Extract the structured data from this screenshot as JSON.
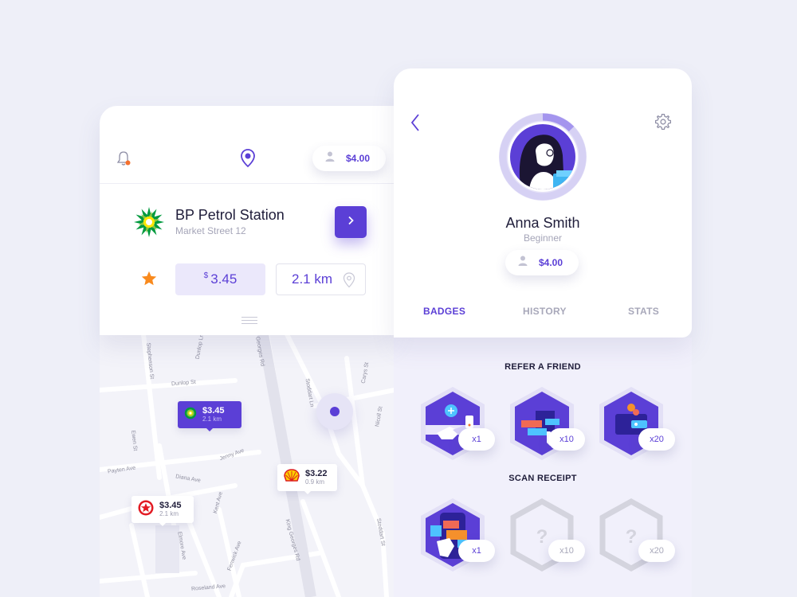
{
  "station_card": {
    "notification_icon": "bell-icon",
    "location_icon": "map-pin-icon",
    "wallet": {
      "icon": "user-icon",
      "amount": "$4.00"
    },
    "station": {
      "logo": "bp-logo-icon",
      "name": "BP Petrol Station",
      "address": "Market Street 12",
      "go_icon": "chevron-right-icon"
    },
    "favorite_icon": "star-icon",
    "price": {
      "currency": "$",
      "value": "3.45"
    },
    "distance": {
      "value": "2.1 km",
      "icon": "location-outline-icon"
    },
    "handle_icon": "drag-handle-icon"
  },
  "map": {
    "streets": [
      "Dunlop Ln",
      "Dunlop St",
      "Stephenson St",
      "Georges Rd",
      "Ewen St",
      "Payten Ave",
      "Diana Ave",
      "Kent Ave",
      "Fenwick Ave",
      "Roseland Ave",
      "Stoddart Ln",
      "Carys St",
      "Nicoll St",
      "King Georges Rd",
      "Jenny Ave",
      "Elmore Ave",
      "Stoddart St"
    ],
    "pins": [
      {
        "brand": "bp-logo-icon",
        "price": "$3.45",
        "distance": "2.1 km",
        "active": true
      },
      {
        "brand": "shell-logo-icon",
        "price": "$3.22",
        "distance": "0.9 km",
        "active": false
      },
      {
        "brand": "texaco-logo-icon",
        "price": "$3.45",
        "distance": "2.1 km",
        "active": false
      }
    ],
    "current_location_icon": "current-location-icon"
  },
  "profile": {
    "back_icon": "chevron-left-icon",
    "settings_icon": "gear-icon",
    "avatar": "user-avatar",
    "name": "Anna Smith",
    "level": "Beginner",
    "level_progress": 0.3,
    "wallet": {
      "icon": "user-icon",
      "amount": "$4.00"
    },
    "tabs": [
      {
        "label": "BADGES",
        "active": true
      },
      {
        "label": "HISTORY",
        "active": false
      },
      {
        "label": "STATS",
        "active": false
      }
    ]
  },
  "badges": {
    "sections": [
      {
        "title": "REFER A FRIEND",
        "items": [
          {
            "icon": "handshake-badge-icon",
            "count": "x1",
            "locked": false
          },
          {
            "icon": "cards-badge-icon",
            "count": "x10",
            "locked": false
          },
          {
            "icon": "wallet-badge-icon",
            "count": "x20",
            "locked": false
          }
        ]
      },
      {
        "title": "SCAN RECEIPT",
        "items": [
          {
            "icon": "scan-badge-icon",
            "count": "x1",
            "locked": false
          },
          {
            "icon": "question-badge-icon",
            "count": "x10",
            "locked": true
          },
          {
            "icon": "question-badge-icon",
            "count": "x20",
            "locked": true
          }
        ]
      }
    ]
  },
  "colors": {
    "background": "#eeeff8",
    "accent": "#5b3fd6",
    "accent_light": "#ebe8fb",
    "star": "#f98a1d",
    "notification_dot": "#f5702c"
  }
}
